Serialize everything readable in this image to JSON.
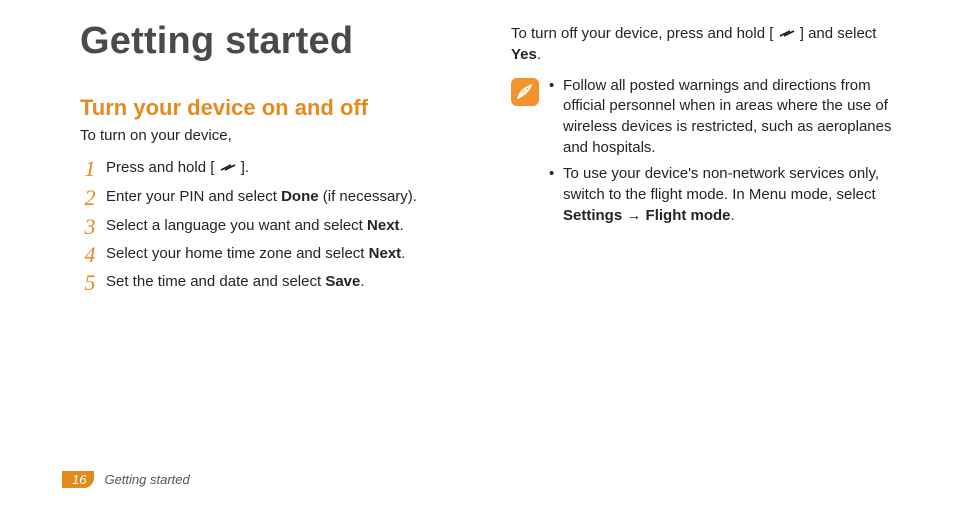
{
  "chapter_title": "Getting started",
  "section_title": "Turn your device on and off",
  "lead_in": "To turn on your device,",
  "steps": [
    {
      "num": "1",
      "a": "Press and hold [",
      "b": "]."
    },
    {
      "num": "2",
      "a": "Enter your PIN and select ",
      "bold": "Done",
      "b": " (if necessary)."
    },
    {
      "num": "3",
      "a": "Select a language you want and select ",
      "bold": "Next",
      "b": "."
    },
    {
      "num": "4",
      "a": "Select your home time zone and select ",
      "bold": "Next",
      "b": "."
    },
    {
      "num": "5",
      "a": "Set the time and date and select ",
      "bold": "Save",
      "b": "."
    }
  ],
  "right": {
    "off_a": "To turn off your device, press and hold [",
    "off_b": "] and select ",
    "off_bold": "Yes",
    "off_c": ".",
    "bullets": [
      {
        "text": "Follow all posted warnings and directions from official personnel when in areas where the use of wireless devices is restricted, such as aeroplanes and hospitals."
      },
      {
        "a": "To use your device's non-network services only, switch to the flight mode. In Menu mode, select ",
        "bold1": "Settings",
        "arrow": " → ",
        "bold2": "Flight mode",
        "end": "."
      }
    ]
  },
  "footer": {
    "page_number": "16",
    "crumb": "Getting started"
  }
}
